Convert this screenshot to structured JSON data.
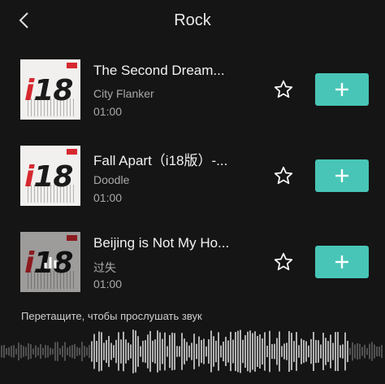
{
  "header": {
    "title": "Rock"
  },
  "tracks": [
    {
      "title": "The Second Dream...",
      "artist": "City Flanker",
      "duration": "01:00",
      "playing": false
    },
    {
      "title": "Fall Apart（i18版）-...",
      "artist": "Doodle",
      "duration": "01:00",
      "playing": false
    },
    {
      "title": "Beijing is Not My Ho...",
      "artist": "过失",
      "duration": "01:00",
      "playing": true
    }
  ],
  "cover": {
    "logo_i": "i",
    "logo_rest": "18"
  },
  "icons": {
    "back": "chevron-left-icon",
    "favorite": "star-outline-icon",
    "add": "plus-icon"
  },
  "colors": {
    "accent": "#48c5b6",
    "background": "#151515",
    "logo_red": "#d7282f"
  },
  "footer": {
    "hint": "Перетащите, чтобы прослушать звук"
  }
}
